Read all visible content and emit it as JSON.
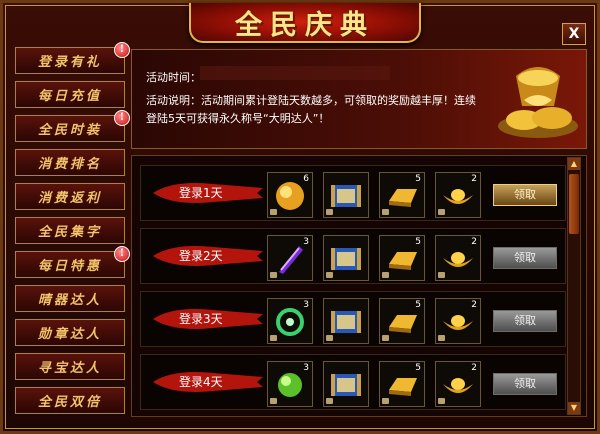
{
  "window": {
    "title": "全民庆典",
    "close_label": "X"
  },
  "sidebar": {
    "items": [
      {
        "label": "登录有礼",
        "active": true,
        "badge": "!"
      },
      {
        "label": "每日充值",
        "active": false,
        "badge": ""
      },
      {
        "label": "全民时装",
        "active": false,
        "badge": "!"
      },
      {
        "label": "消费排名",
        "active": false,
        "badge": ""
      },
      {
        "label": "消费返利",
        "active": false,
        "badge": ""
      },
      {
        "label": "全民集字",
        "active": false,
        "badge": ""
      },
      {
        "label": "每日特惠",
        "active": false,
        "badge": "!"
      },
      {
        "label": "晴器达人",
        "active": false,
        "badge": ""
      },
      {
        "label": "勋章达人",
        "active": false,
        "badge": ""
      },
      {
        "label": "寻宝达人",
        "active": false,
        "badge": ""
      },
      {
        "label": "全民双倍",
        "active": false,
        "badge": ""
      }
    ]
  },
  "info": {
    "time_label": "活动时间：",
    "desc": "活动说明：活动期间累计登陆天数越多，可领取的奖励越丰厚！连续登陆5天可获得永久称号“大明达人”！"
  },
  "rows": [
    {
      "label": "登录1天",
      "items": [
        {
          "icon": "gold-orb-icon",
          "count": "6"
        },
        {
          "icon": "scroll-icon",
          "count": ""
        },
        {
          "icon": "gold-bar-icon",
          "count": "5"
        },
        {
          "icon": "gold-ingot-icon",
          "count": "2"
        }
      ],
      "claim": "领取",
      "claim_enabled": true
    },
    {
      "label": "登录2天",
      "items": [
        {
          "icon": "purple-crystal-icon",
          "count": "3"
        },
        {
          "icon": "scroll-icon",
          "count": ""
        },
        {
          "icon": "gold-bar-icon",
          "count": "5"
        },
        {
          "icon": "gold-ingot-icon",
          "count": "2"
        }
      ],
      "claim": "领取",
      "claim_enabled": false
    },
    {
      "label": "登录3天",
      "items": [
        {
          "icon": "green-jade-icon",
          "count": "3"
        },
        {
          "icon": "scroll-icon",
          "count": ""
        },
        {
          "icon": "gold-bar-icon",
          "count": "5"
        },
        {
          "icon": "gold-ingot-icon",
          "count": "2"
        }
      ],
      "claim": "领取",
      "claim_enabled": false
    },
    {
      "label": "登录4天",
      "items": [
        {
          "icon": "green-orb-icon",
          "count": "3"
        },
        {
          "icon": "scroll-icon",
          "count": ""
        },
        {
          "icon": "gold-bar-icon",
          "count": "5"
        },
        {
          "icon": "gold-ingot-icon",
          "count": "2"
        }
      ],
      "claim": "领取",
      "claim_enabled": false
    }
  ],
  "colors": {
    "accent": "#e3b448",
    "banner": "#b3150c",
    "frame": "#6b3a10"
  }
}
